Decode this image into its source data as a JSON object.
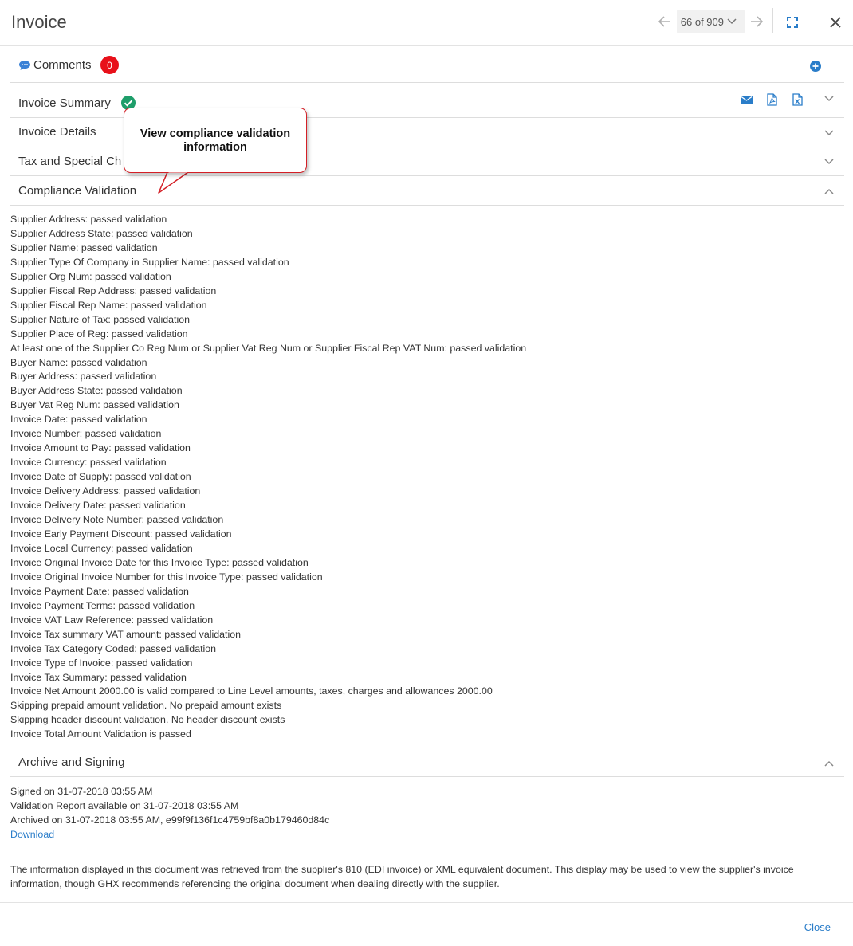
{
  "header": {
    "title": "Invoice",
    "pager_label": "66 of 909"
  },
  "sections": {
    "comments": {
      "label": "Comments",
      "count": "0"
    },
    "summary": {
      "label": "Invoice Summary"
    },
    "details": {
      "label": "Invoice Details"
    },
    "tax": {
      "label": "Tax and Special Ch"
    },
    "compliance": {
      "label": "Compliance Validation"
    },
    "archive": {
      "label": "Archive and Signing"
    }
  },
  "callout": {
    "line1": "View compliance validation",
    "line2": "information"
  },
  "validation": [
    "Supplier Address: passed validation",
    "Supplier Address State: passed validation",
    "Supplier Name: passed validation",
    "Supplier Type Of Company in Supplier Name: passed validation",
    "Supplier Org Num: passed validation",
    "Supplier Fiscal Rep Address: passed validation",
    "Supplier Fiscal Rep Name: passed validation",
    "Supplier Nature of Tax: passed validation",
    "Supplier Place of Reg: passed validation",
    "At least one of the Supplier Co Reg Num or Supplier Vat Reg Num or Supplier Fiscal Rep VAT Num: passed validation",
    "Buyer Name: passed validation",
    "Buyer Address: passed validation",
    "Buyer Address State: passed validation",
    "Buyer Vat Reg Num: passed validation",
    "Invoice Date: passed validation",
    "Invoice Number: passed validation",
    "Invoice Amount to Pay: passed validation",
    "Invoice Currency: passed validation",
    "Invoice Date of Supply: passed validation",
    "Invoice Delivery Address: passed validation",
    "Invoice Delivery Date: passed validation",
    "Invoice Delivery Note Number: passed validation",
    "Invoice Early Payment Discount: passed validation",
    "Invoice Local Currency: passed validation",
    "Invoice Original Invoice Date for this Invoice Type: passed validation",
    "Invoice Original Invoice Number for this Invoice Type: passed validation",
    "Invoice Payment Date: passed validation",
    "Invoice Payment Terms: passed validation",
    "Invoice VAT Law Reference: passed validation",
    "Invoice Tax summary VAT amount: passed validation",
    "Invoice Tax Category Coded: passed validation",
    "Invoice Type of Invoice: passed validation",
    "Invoice Tax Summary: passed validation",
    "Invoice Net Amount 2000.00 is valid compared to Line Level amounts, taxes, charges and allowances 2000.00",
    "Skipping prepaid amount validation. No prepaid amount exists",
    "Skipping header discount validation. No header discount exists",
    "Invoice Total Amount Validation is passed"
  ],
  "archive": {
    "signed": "Signed on 31-07-2018 03:55 AM",
    "report": "Validation Report available on 31-07-2018 03:55 AM",
    "archived": "Archived on 31-07-2018 03:55 AM, e99f9f136f1c4759bf8a0b179460d84c",
    "download_label": "Download"
  },
  "notice": "The information displayed in this document was retrieved from the supplier's 810 (EDI invoice) or XML equivalent document. This display may be used to view the supplier's invoice information, though GHX recommends referencing the original document when dealing directly with the supplier.",
  "footer": {
    "close_label": "Close"
  },
  "icons": {
    "prev": "arrow-left-icon",
    "next": "arrow-right-icon",
    "dropdown": "chevron-down-icon",
    "expand": "fullscreen-icon",
    "close": "close-icon",
    "comment": "speech-bubble-icon",
    "add": "plus-circle-icon",
    "valid": "check-circle-icon",
    "email": "envelope-icon",
    "pdf": "pdf-file-icon",
    "excel": "excel-file-icon"
  },
  "colors": {
    "accent": "#2a7dc9",
    "badge": "#e8101a",
    "success": "#1e9e6a",
    "callout_border": "#d41f26"
  }
}
